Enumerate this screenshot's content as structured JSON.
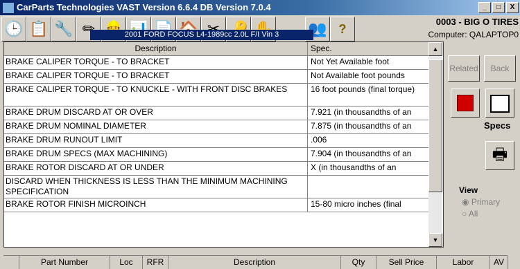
{
  "window": {
    "title": "CarParts Technologies VAST Version 6.6.4   DB Version 7.0.4",
    "controls": [
      "_",
      "□",
      "X"
    ]
  },
  "store": {
    "code": "0003 - BIG O TIRES",
    "computer": "Computer: QALAPTOP0"
  },
  "vehicle": "2001 FORD FOCUS L4-1989cc 2.0L F/I Vin 3",
  "grid": {
    "headers": {
      "description": "Description",
      "spec": "Spec."
    },
    "rows": [
      {
        "description": "BRAKE CALIPER TORQUE - TO BRACKET",
        "spec": "Not Yet Available  foot"
      },
      {
        "description": "BRAKE CALIPER TORQUE - TO BRACKET",
        "spec": "Not Available  foot pounds"
      },
      {
        "description": "BRAKE CALIPER TORQUE - TO KNUCKLE - WITH FRONT DISC BRAKES",
        "spec": "16  foot pounds  (final torque)"
      },
      {
        "description": "BRAKE DRUM DISCARD AT OR OVER",
        "spec": "7.921  (in thousandths of an"
      },
      {
        "description": "BRAKE DRUM NOMINAL DIAMETER",
        "spec": "7.875  (in thousandths of an"
      },
      {
        "description": "BRAKE DRUM RUNOUT LIMIT",
        "spec": ".006"
      },
      {
        "description": "BRAKE DRUM SPECS (MAX MACHINING)",
        "spec": "7.904  (in thousandths of an"
      },
      {
        "description": "BRAKE ROTOR DISCARD AT OR UNDER",
        "spec": "X  (in thousandths of an"
      },
      {
        "description": "DISCARD WHEN THICKNESS IS LESS THAN THE MINIMUM MACHINING SPECIFICATION",
        "spec": ""
      },
      {
        "description": "BRAKE ROTOR FINISH MICROINCH",
        "spec": "15-80  micro inches  (final"
      }
    ]
  },
  "side": {
    "related": "Related",
    "back": "Back",
    "specs": "Specs"
  },
  "view": {
    "label": "View",
    "primary": "Primary",
    "all": "All"
  },
  "parts": {
    "headers": [
      "Part Number",
      "Loc",
      "RFR",
      "Description",
      "Qty",
      "Sell Price",
      "Labor",
      "AV"
    ],
    "new_row_marker": "*"
  },
  "toolbar_icons": [
    "clock-icon",
    "worksheet-icon",
    "parts-icon",
    "pencil-icon",
    "mechanic-icon",
    "chart-icon",
    "document-icon",
    "garage-icon",
    "broken-link-icon",
    "key-icon",
    "hand-icon",
    "people-icon",
    "question-icon"
  ]
}
